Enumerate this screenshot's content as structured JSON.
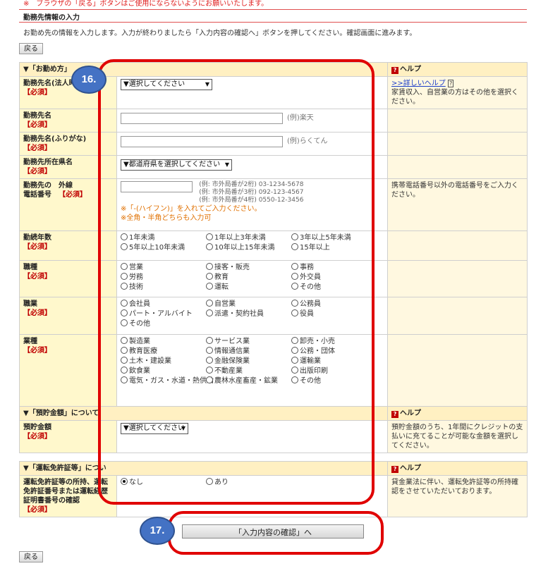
{
  "notice": "※　ブラウザの「戻る」ボタンはご使用にならないようにお願いいたします。",
  "section_title": "勤務先情報の入力",
  "intro": "お勤め先の情報を入力します。入力が終わりましたら「入力内容の確認へ」ボタンを押してください。確認画面に進みます。",
  "back_label": "戻る",
  "required_label": "【必須】",
  "help_header": "ヘルプ",
  "help_badge": "?",
  "employer": {
    "header": "▼「お勤め方」",
    "name_label": "勤務先名(法人時",
    "name_select": "▼選択してください",
    "help_link": ">>詳しいヘルプ",
    "help_text": "家賃収入、自営業の方はその他を選択ください。",
    "company_label": "勤務先名",
    "company_example": "(例)楽天",
    "kana_label": "勤務先名(ふりがな)",
    "kana_example": "(例)らくてん",
    "pref_label": "勤務先所在県名",
    "pref_select": "▼都道府県を選択してください",
    "phone_label_1": "勤務先の",
    "phone_label_2": "電話番号",
    "phone_ext": "外線",
    "phone_ex1": "(例: 市外局番が2桁)  03-1234-5678",
    "phone_ex2": "(例: 市外局番が3桁)  092-123-4567",
    "phone_ex3": "(例: 市外局番が4桁)  0550-12-3456",
    "phone_note1": "※「-(ハイフン)」を入れてご入力ください。",
    "phone_note2": "※全角・半角どちらも入力可",
    "phone_help": "携帯電話番号以外の電話番号をご入力ください。",
    "years_label": "勤続年数",
    "years_options": [
      "1年未満",
      "1年以上3年未満",
      "3年以上5年未満",
      "5年以上10年未満",
      "10年以上15年未満",
      "15年以上"
    ],
    "job_label": "職種",
    "job_options": [
      "営業",
      "接客・販売",
      "事務",
      "労務",
      "教育",
      "外交員",
      "技術",
      "運転",
      "その他"
    ],
    "occupation_label": "職業",
    "occupation_options": [
      "会社員",
      "自営業",
      "公務員",
      "パート・アルバイト",
      "派遣・契約社員",
      "役員",
      "その他"
    ],
    "industry_label": "業種",
    "industry_options": [
      "製造業",
      "サービス業",
      "卸売・小売",
      "教育医療",
      "情報通信業",
      "公務・団体",
      "土木・建設業",
      "金融保険業",
      "運輸業",
      "飲食業",
      "不動産業",
      "出版印刷",
      "電気・ガス・水道・熱供給",
      "農林水産畜産・鉱業",
      "その他"
    ]
  },
  "savings": {
    "header": "▼「預貯金額」について",
    "label": "預貯金額",
    "select": "▼選択してください",
    "help_text": "預貯金額のうち、1年間にクレジットの支払いに充てることが可能な金額を選択してください。"
  },
  "license": {
    "header": "▼「運転免許証等」につい",
    "label": "運転免許証等の所持、運転免許証番号または運転経歴証明書番号の確認",
    "options": [
      "なし",
      "あり"
    ],
    "selected": "なし",
    "help_text": "貸金業法に伴い、運転免許証等の所持確認をさせていただいております。"
  },
  "confirm_label": "「入力内容の確認」へ",
  "annotations": {
    "first": "16.",
    "second": "17."
  },
  "colors": {
    "annotation_red": "#e00000",
    "annotation_blue": "#4472c4",
    "label_bg": "#fff8cc",
    "required": "#c00000"
  }
}
